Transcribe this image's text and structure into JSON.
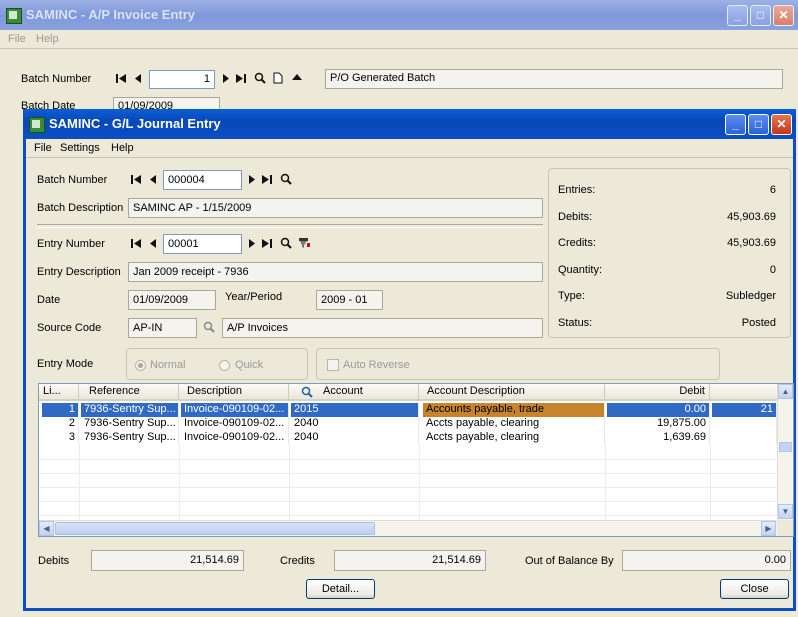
{
  "back_window": {
    "title": "SAMINC - A/P Invoice Entry",
    "menu": [
      "File",
      "Help"
    ],
    "batch_number_label": "Batch Number",
    "batch_number_value": "1",
    "batch_description": "P/O Generated Batch",
    "batch_date_label": "Batch Date",
    "batch_date_value": "01/09/2009"
  },
  "front_window": {
    "title": "SAMINC - G/L Journal Entry",
    "menu": [
      "File",
      "Settings",
      "Help"
    ],
    "batch_number_label": "Batch Number",
    "batch_number_value": "000004",
    "batch_description_label": "Batch Description",
    "batch_description_value": "SAMINC AP - 1/15/2009",
    "entry_number_label": "Entry Number",
    "entry_number_value": "00001",
    "entry_description_label": "Entry Description",
    "entry_description_value": "Jan 2009 receipt - 7936",
    "date_label": "Date",
    "date_value": "01/09/2009",
    "year_period_label": "Year/Period",
    "year_period_value": "2009 - 01",
    "source_code_label": "Source Code",
    "source_code_value": "AP-IN",
    "source_code_desc": "A/P Invoices",
    "entry_mode_label": "Entry Mode",
    "entry_mode_normal": "Normal",
    "entry_mode_quick": "Quick",
    "auto_reverse_label": "Auto Reverse",
    "stats": {
      "entries_label": "Entries:",
      "entries_value": "6",
      "debits_label": "Debits:",
      "debits_value": "45,903.69",
      "credits_label": "Credits:",
      "credits_value": "45,903.69",
      "quantity_label": "Quantity:",
      "quantity_value": "0",
      "type_label": "Type:",
      "type_value": "Subledger",
      "status_label": "Status:",
      "status_value": "Posted"
    },
    "grid": {
      "columns": [
        "Li...",
        "Reference",
        "Description",
        "Account",
        "Account Description",
        "Debit"
      ],
      "rows": [
        {
          "line": "1",
          "reference": "7936-Sentry Sup...",
          "description": "Invoice-090109-02...",
          "account": "2015",
          "account_desc": "Accounts payable, trade",
          "debit": "0.00",
          "extra": "21"
        },
        {
          "line": "2",
          "reference": "7936-Sentry Sup...",
          "description": "Invoice-090109-02...",
          "account": "2040",
          "account_desc": "Accts payable, clearing",
          "debit": "19,875.00",
          "extra": ""
        },
        {
          "line": "3",
          "reference": "7936-Sentry Sup...",
          "description": "Invoice-090109-02...",
          "account": "2040",
          "account_desc": "Accts payable, clearing",
          "debit": "1,639.69",
          "extra": ""
        }
      ]
    },
    "totals": {
      "debits_label": "Debits",
      "debits_value": "21,514.69",
      "credits_label": "Credits",
      "credits_value": "21,514.69",
      "out_of_balance_label": "Out of Balance By",
      "out_of_balance_value": "0.00"
    },
    "detail_button": "Detail...",
    "close_button": "Close"
  }
}
